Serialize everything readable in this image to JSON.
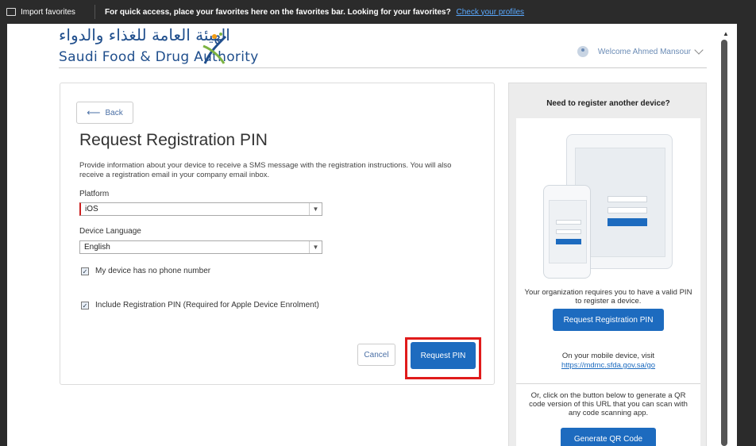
{
  "favorites_bar": {
    "import_label": "Import favorites",
    "message": "For quick access, place your favorites here on the favorites bar. Looking for your favorites?",
    "link": "Check your profiles"
  },
  "header": {
    "logo_arabic": "الهيئة العامة للغذاء والدواء",
    "logo_english": "Saudi Food & Drug Authority",
    "welcome": "Welcome Ahmed Mansour"
  },
  "form": {
    "back_label": "Back",
    "title": "Request Registration PIN",
    "description": "Provide information about your device to receive a SMS message with the registration instructions. You will also receive a registration email in your company email inbox.",
    "platform_label": "Platform",
    "platform_value": "iOS",
    "language_label": "Device Language",
    "language_value": "English",
    "no_phone_label": "My device has no phone number",
    "no_phone_checked": true,
    "include_pin_label": "Include Registration PIN (Required for Apple Device Enrolment)",
    "include_pin_checked": true,
    "cancel_label": "Cancel",
    "submit_label": "Request PIN"
  },
  "sidebar": {
    "title": "Need to register another device?",
    "pin_text": "Your organization requires you to have a valid PIN to register a device.",
    "pin_button": "Request Registration PIN",
    "visit_text": "On your mobile device, visit",
    "visit_url": "https://mdmc.sfda.gov.sa/go",
    "qr_text": "Or, click on the button below to generate a QR code version of this URL that you can scan with any code scanning app.",
    "qr_button": "Generate QR Code"
  },
  "colors": {
    "accent": "#1d6bbf",
    "highlight": "#e01b1b",
    "brand": "#1f4e8c"
  }
}
